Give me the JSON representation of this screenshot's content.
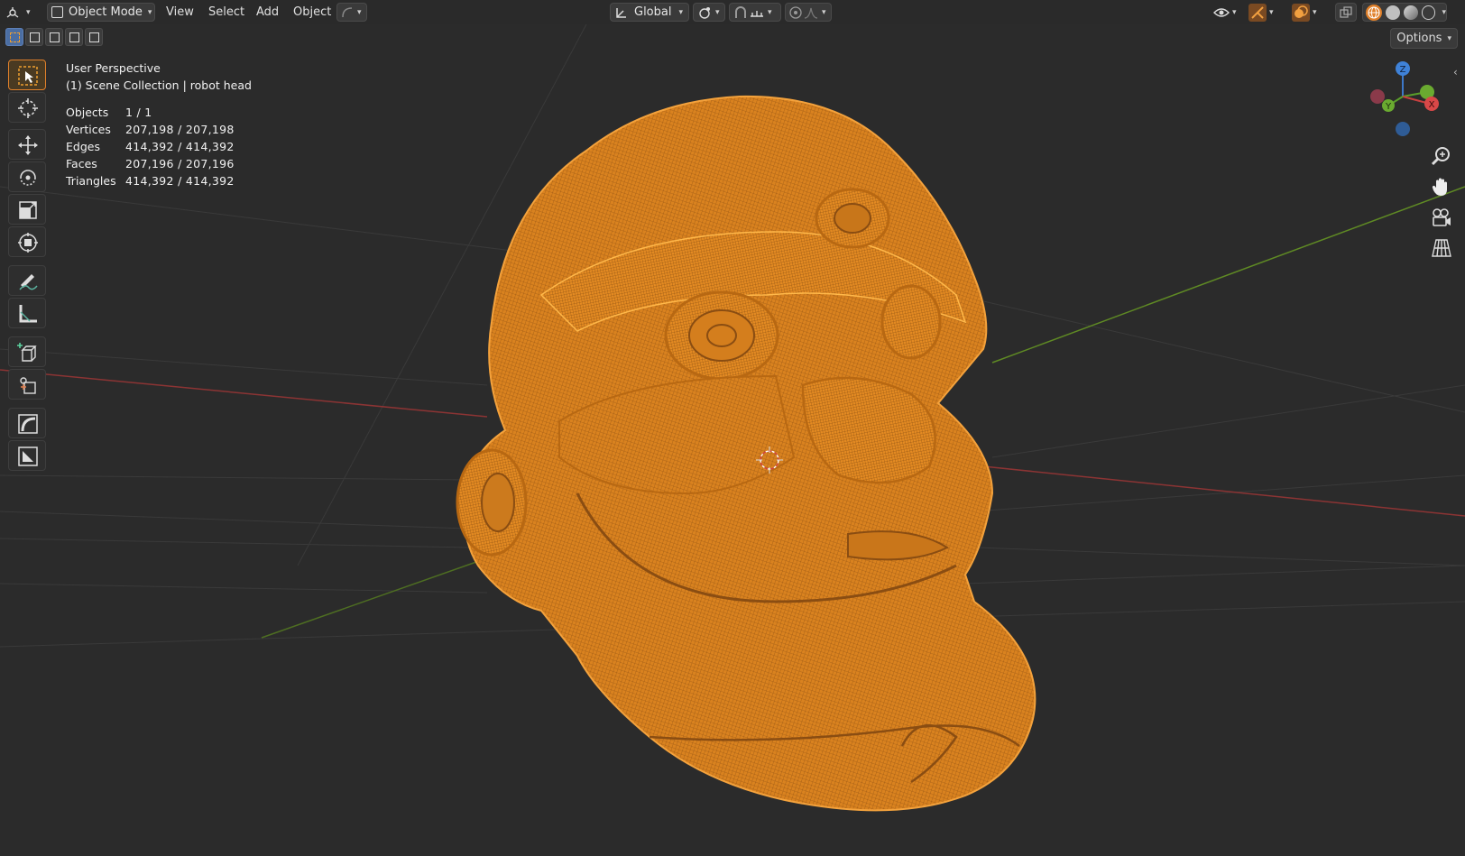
{
  "header": {
    "editor_type_icon": "3d-viewport-icon",
    "mode_label": "Object Mode",
    "menus": [
      "View",
      "Select",
      "Add",
      "Object"
    ],
    "transform_orientation": "Global",
    "options_label": "Options"
  },
  "overlay": {
    "view_name": "User Perspective",
    "collection": "(1) Scene Collection | robot head"
  },
  "stats": [
    {
      "key": "Objects",
      "value": "1 / 1"
    },
    {
      "key": "Vertices",
      "value": "207,198 / 207,198"
    },
    {
      "key": "Edges",
      "value": "414,392 / 414,392"
    },
    {
      "key": "Faces",
      "value": "207,196 / 207,196"
    },
    {
      "key": "Triangles",
      "value": "414,392 / 414,392"
    }
  ],
  "gizmo": {
    "x": "X",
    "y": "Y",
    "z": "Z"
  },
  "toolbar_tools": [
    "select-box-icon",
    "cursor-icon",
    "move-icon",
    "rotate-icon",
    "scale-icon",
    "transform-icon",
    "annotate-icon",
    "measure-icon",
    "add-cube-icon",
    "add-object-icon",
    "shear-icon",
    "shrink-icon"
  ],
  "colors": {
    "background": "#2b2b2b",
    "mesh_wire": "#f39a2c",
    "active_tool": "#e0802a",
    "x_axis": "#a83a3a",
    "y_axis": "#6a9a2a"
  }
}
